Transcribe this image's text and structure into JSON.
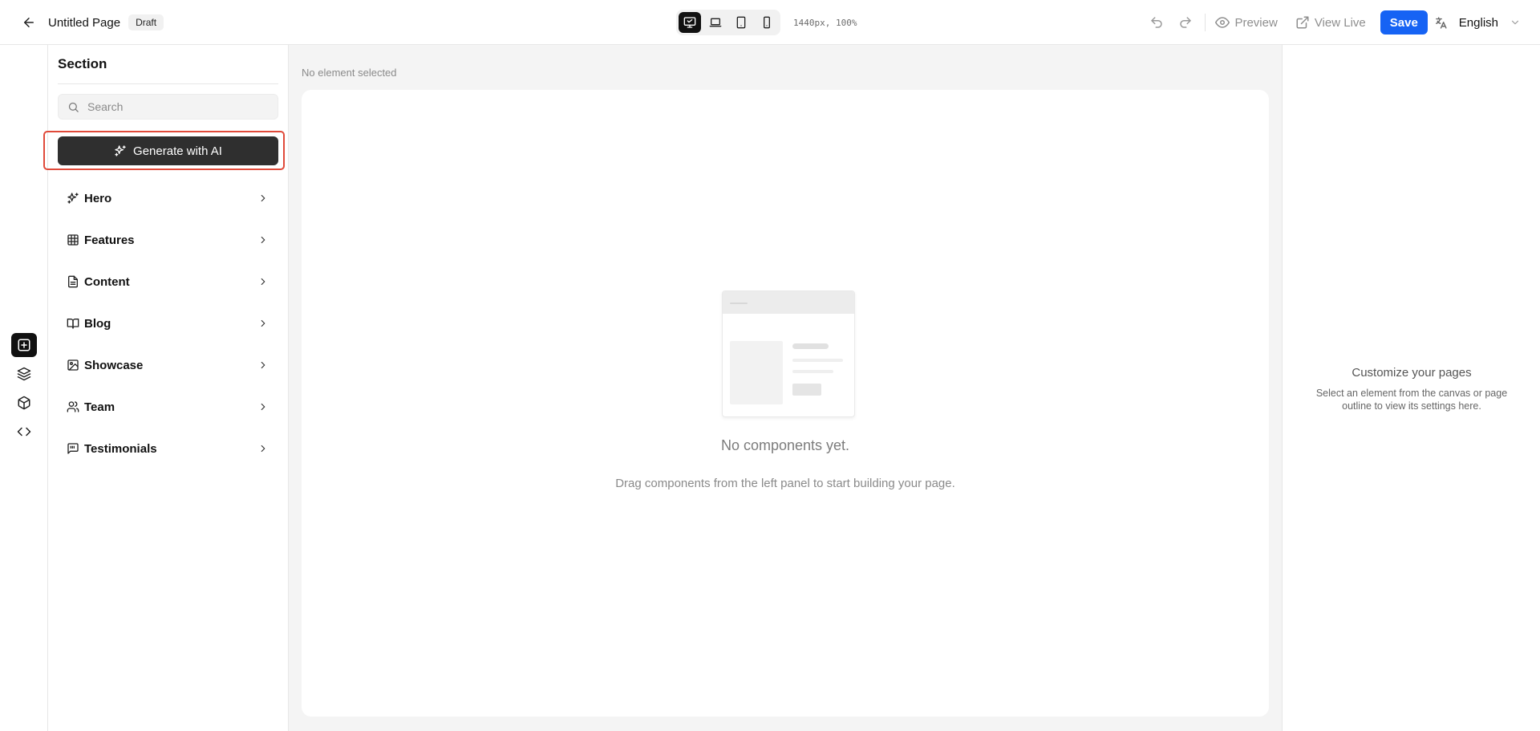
{
  "header": {
    "title": "Untitled Page",
    "status": "Draft",
    "viewport": "1440px, 100%",
    "preview_label": "Preview",
    "view_live_label": "View Live",
    "save_label": "Save",
    "language": "English",
    "accent_color": "#1663f4"
  },
  "devices": [
    {
      "icon": "desktop-icon",
      "active": true
    },
    {
      "icon": "laptop-icon",
      "active": false
    },
    {
      "icon": "tablet-icon",
      "active": false
    },
    {
      "icon": "mobile-icon",
      "active": false
    }
  ],
  "rail": [
    {
      "icon": "add-section-icon",
      "active": true
    },
    {
      "icon": "layers-icon",
      "active": false
    },
    {
      "icon": "components-icon",
      "active": false
    },
    {
      "icon": "code-icon",
      "active": false
    }
  ],
  "panel": {
    "title": "Section",
    "search_placeholder": "Search",
    "ai_button_label": "Generate with AI",
    "categories": [
      {
        "label": "Hero",
        "icon": "sparkles-icon"
      },
      {
        "label": "Features",
        "icon": "grid-icon"
      },
      {
        "label": "Content",
        "icon": "document-icon"
      },
      {
        "label": "Blog",
        "icon": "book-icon"
      },
      {
        "label": "Showcase",
        "icon": "image-icon"
      },
      {
        "label": "Team",
        "icon": "users-icon"
      },
      {
        "label": "Testimonials",
        "icon": "quote-icon"
      }
    ]
  },
  "canvas": {
    "selection_status": "No element selected",
    "empty_title": "No components yet.",
    "empty_subtitle": "Drag components from the left panel to start building your page."
  },
  "settings": {
    "title": "Customize your pages",
    "subtitle": "Select an element from the canvas or page outline to view its settings here."
  }
}
